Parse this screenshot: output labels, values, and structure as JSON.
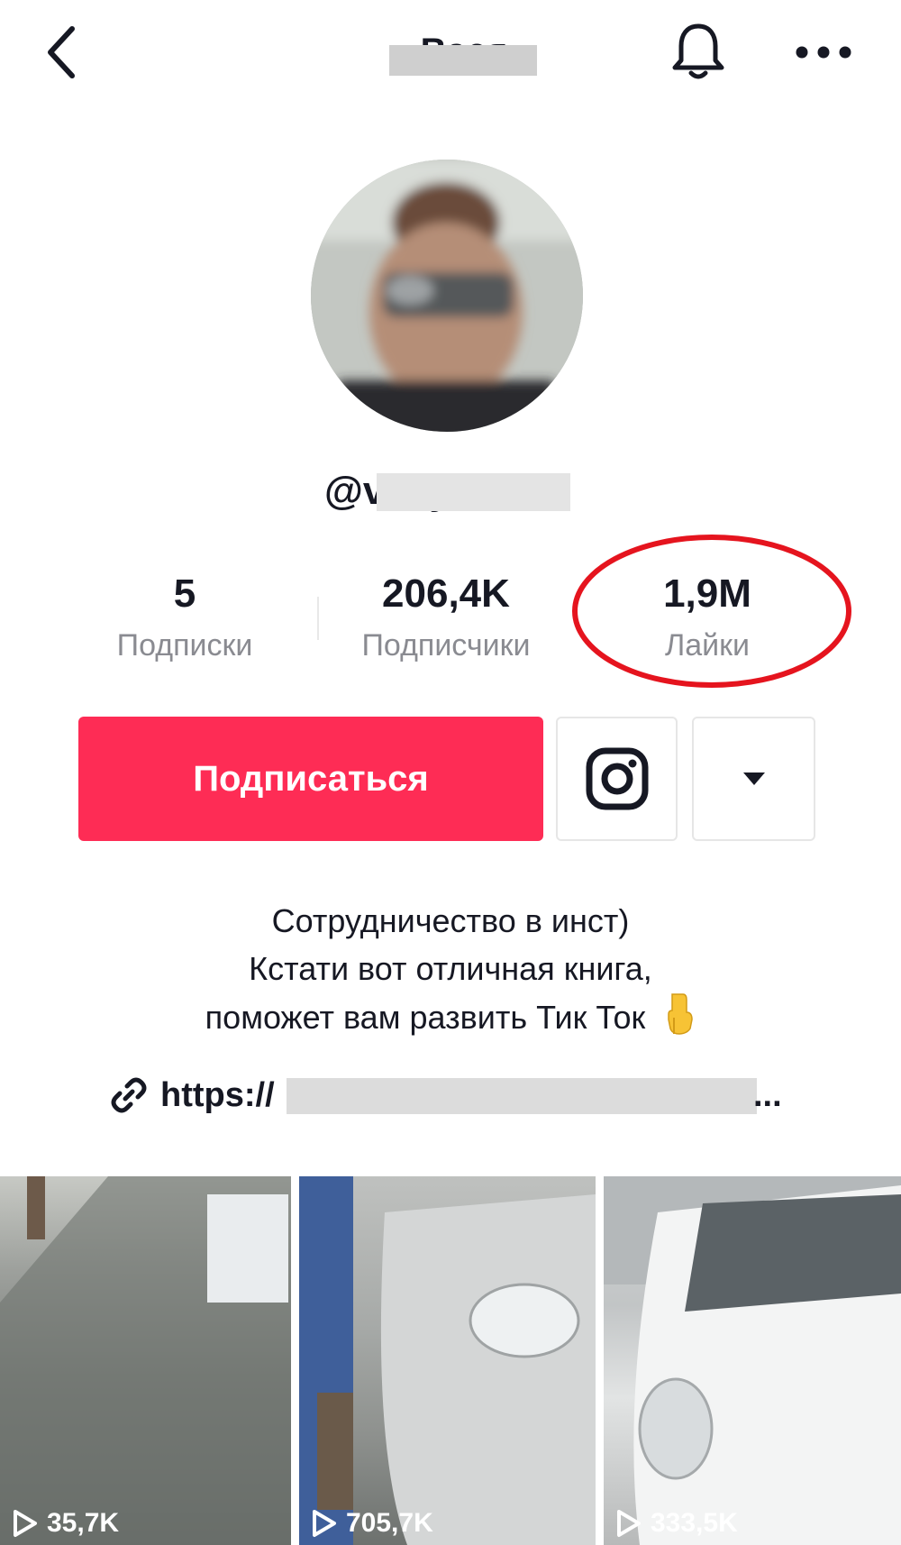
{
  "header": {
    "title": "Вася",
    "back_icon": "chevron-left-icon",
    "bell_icon": "bell-icon",
    "more_icon": "more-horizontal-icon"
  },
  "profile": {
    "username": "@vasya",
    "stats": [
      {
        "value": "5",
        "label": "Подписки"
      },
      {
        "value": "206,4K",
        "label": "Подписчики"
      },
      {
        "value": "1,9M",
        "label": "Лайки"
      }
    ],
    "highlight_color": "#e5141e"
  },
  "actions": {
    "follow_label": "Подписаться",
    "follow_color": "#fe2c55",
    "instagram_icon": "instagram-icon",
    "dropdown_icon": "caret-down-icon"
  },
  "bio": {
    "line1": "Сотрудничество в инст)",
    "line2": "Кстати вот отличная книга,",
    "line3": "поможет вам развить Тик Ток",
    "emoji": "pointing-down-hand",
    "link_prefix": "https://",
    "link_suffix": "...",
    "link_icon": "link-icon"
  },
  "videos": [
    {
      "views": "35,7K"
    },
    {
      "views": "705,7K"
    },
    {
      "views": "333,5K"
    }
  ]
}
